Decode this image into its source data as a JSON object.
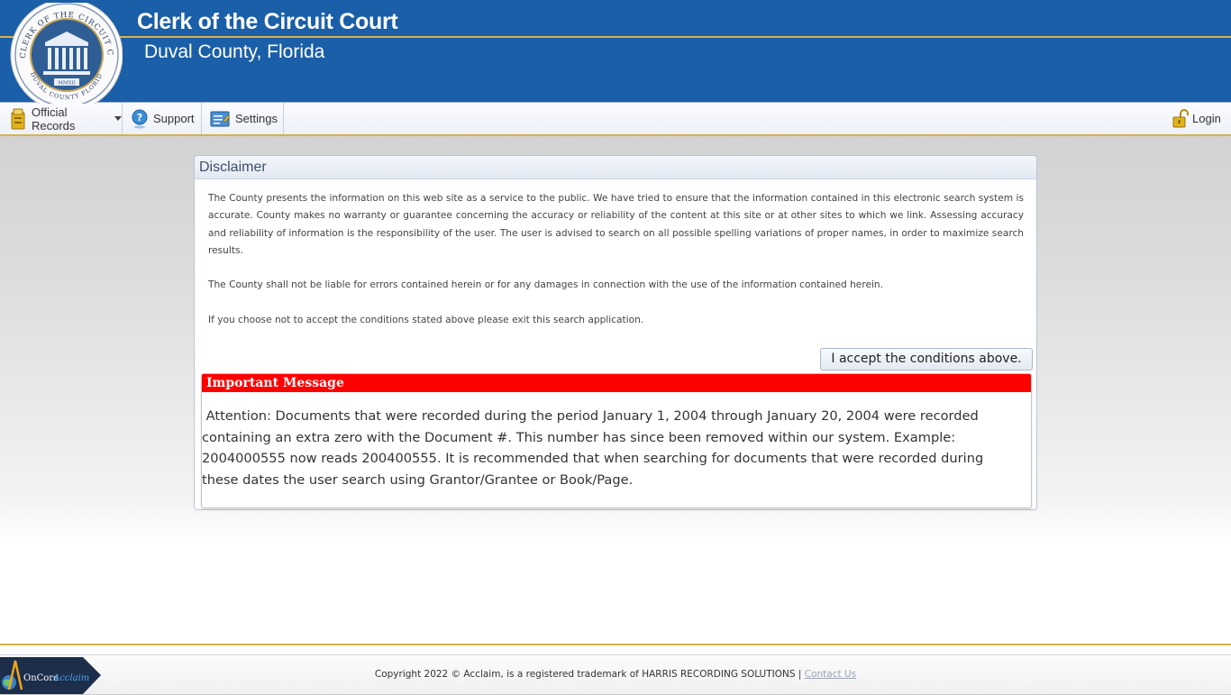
{
  "header": {
    "title": "Clerk of the Circuit Court",
    "subtitle": "Duval County, Florida",
    "seal": {
      "outer_text": "CLERK OF THE CIRCUIT COURT",
      "bottom_text": "DUVAL COUNTY FLORIDA",
      "year": "MMXII"
    }
  },
  "menu": {
    "official_records": "Official Records",
    "support": "Support",
    "settings": "Settings",
    "login": "Login"
  },
  "disclaimer": {
    "title": "Disclaimer",
    "paragraphs": [
      "The County presents the information on this web site as a service to the public. We have tried to ensure that the information contained in this electronic search system is accurate. County makes no warranty or guarantee concerning the accuracy or reliability of the content at this site or at other sites to which we link. Assessing accuracy and reliability of information is the responsibility of the user. The user is advised to search on all possible spelling variations of proper names, in order to maximize search results.",
      "The County shall not be liable for errors contained herein or for any damages in connection with the use of the information contained herein.",
      "If you choose not to accept the conditions stated above please exit this search application."
    ],
    "accept_label": "I accept the conditions above."
  },
  "important": {
    "title": "Important Message",
    "text": " Attention: Documents that were recorded during the period January 1, 2004 through January 20, 2004 were recorded containing an extra zero with the Document #. This number has since been removed within our system. Example: 2004000555 now reads 200400555. It is recommended that when searching for documents that were recorded during these dates the user search using Grantor/Grantee or Book/Page."
  },
  "footer": {
    "copyright": "Copyright 2022 © Acclaim, is a registered trademark of HARRIS RECORDING SOLUTIONS |",
    "contact": "Contact Us",
    "logo_oncore": "OnCore",
    "logo_acclaim": "Acclaim"
  },
  "colors": {
    "header_blue": "#1a5fa8",
    "gold": "#d8b24a",
    "alert_red": "#ff0000"
  }
}
